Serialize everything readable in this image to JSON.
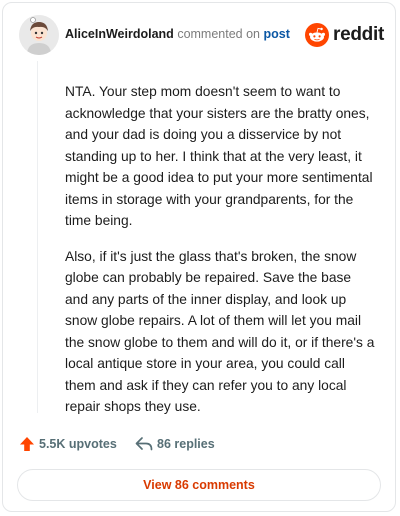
{
  "header": {
    "username": "AliceInWeirdoland",
    "action": "commented on",
    "post_link": "post",
    "brand": "reddit"
  },
  "comment": {
    "paragraphs": [
      "NTA. Your step mom doesn't seem to want to acknowledge that your sisters are the bratty ones, and your dad is doing you a disservice by not standing up to her. I think that at the very least, it might be a good idea to put your more sentimental items in storage with your grandparents, for the time being.",
      "Also, if it's just the glass that's broken, the snow globe can probably be repaired. Save the base and any parts of the inner display, and look up snow globe repairs. A lot of them will let you mail the snow globe to them and will do it, or if there's a local antique store in your area, you could call them and ask if they can refer you to any local repair shops they use."
    ]
  },
  "actions": {
    "upvotes": "5.5K upvotes",
    "replies": "86 replies"
  },
  "view_button": "View 86 comments",
  "colors": {
    "brand_orange": "#ff4500",
    "link_blue": "#0b57a4",
    "button_text": "#d93a00"
  },
  "icons": {
    "avatar": "user-avatar",
    "brand": "reddit-snoo-icon",
    "upvote": "upvote-arrow-icon",
    "reply": "reply-arrow-icon"
  }
}
